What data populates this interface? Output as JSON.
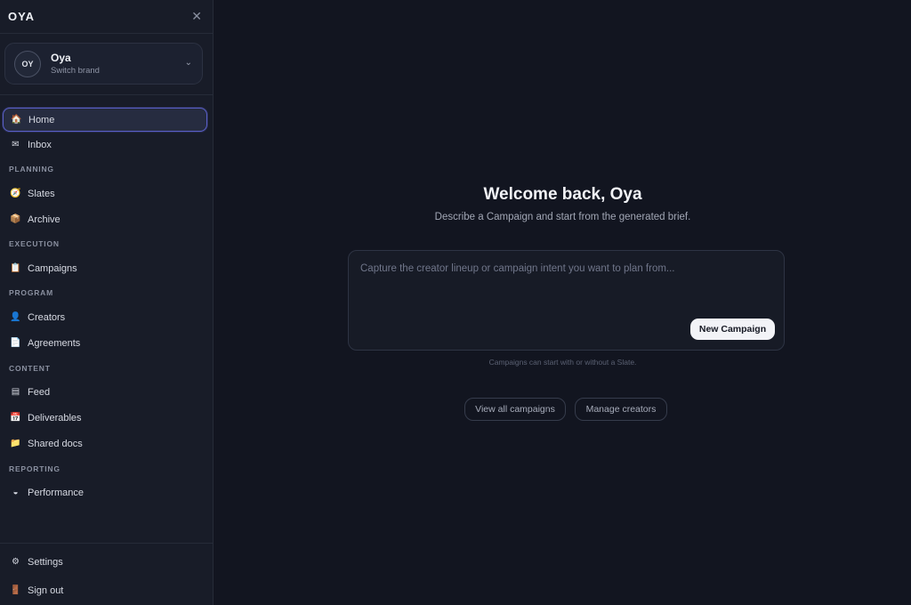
{
  "app": {
    "logo": "OYA"
  },
  "brand": {
    "initials": "OY",
    "name": "Oya",
    "subtitle": "Switch brand"
  },
  "sidebar": {
    "items": [
      {
        "label": "Home",
        "icon": "house-icon",
        "glyph": "🏠"
      },
      {
        "label": "Inbox",
        "icon": "envelope-icon",
        "glyph": "✉"
      }
    ],
    "sections": [
      {
        "label": "PLANNING",
        "items": [
          {
            "label": "Slates",
            "icon": "compass-icon",
            "glyph": "🧭"
          },
          {
            "label": "Archive",
            "icon": "package-icon",
            "glyph": "📦"
          }
        ]
      },
      {
        "label": "EXECUTION",
        "items": [
          {
            "label": "Campaigns",
            "icon": "clipboard-icon",
            "glyph": "📋"
          }
        ]
      },
      {
        "label": "PROGRAM",
        "items": [
          {
            "label": "Creators",
            "icon": "person-icon",
            "glyph": "👤"
          },
          {
            "label": "Agreements",
            "icon": "document-icon",
            "glyph": "📄"
          }
        ]
      },
      {
        "label": "CONTENT",
        "items": [
          {
            "label": "Feed",
            "icon": "feed-icon",
            "glyph": "▤"
          },
          {
            "label": "Deliverables",
            "icon": "calendar-icon",
            "glyph": "📅"
          },
          {
            "label": "Shared docs",
            "icon": "folder-icon",
            "glyph": "📁"
          }
        ]
      },
      {
        "label": "REPORTING",
        "items": [
          {
            "label": "Performance",
            "icon": "half-circle-icon",
            "glyph": "◒"
          }
        ]
      }
    ],
    "footer": [
      {
        "label": "Settings",
        "icon": "gear-icon",
        "glyph": "⚙"
      },
      {
        "label": "Sign out",
        "icon": "door-icon",
        "glyph": "🚪"
      }
    ]
  },
  "main": {
    "title": "Welcome back, Oya",
    "subtitle": "Describe a Campaign and start from the generated brief.",
    "composer": {
      "placeholder": "Capture the creator lineup or campaign intent you want to plan from...",
      "button": "New Campaign"
    },
    "hint": "Campaigns can start with or without a Slate.",
    "actions": [
      "View all campaigns",
      "Manage creators"
    ]
  },
  "colors": {
    "accent": "#5a60c8",
    "background": "#121520",
    "sidebar": "#181c28"
  }
}
